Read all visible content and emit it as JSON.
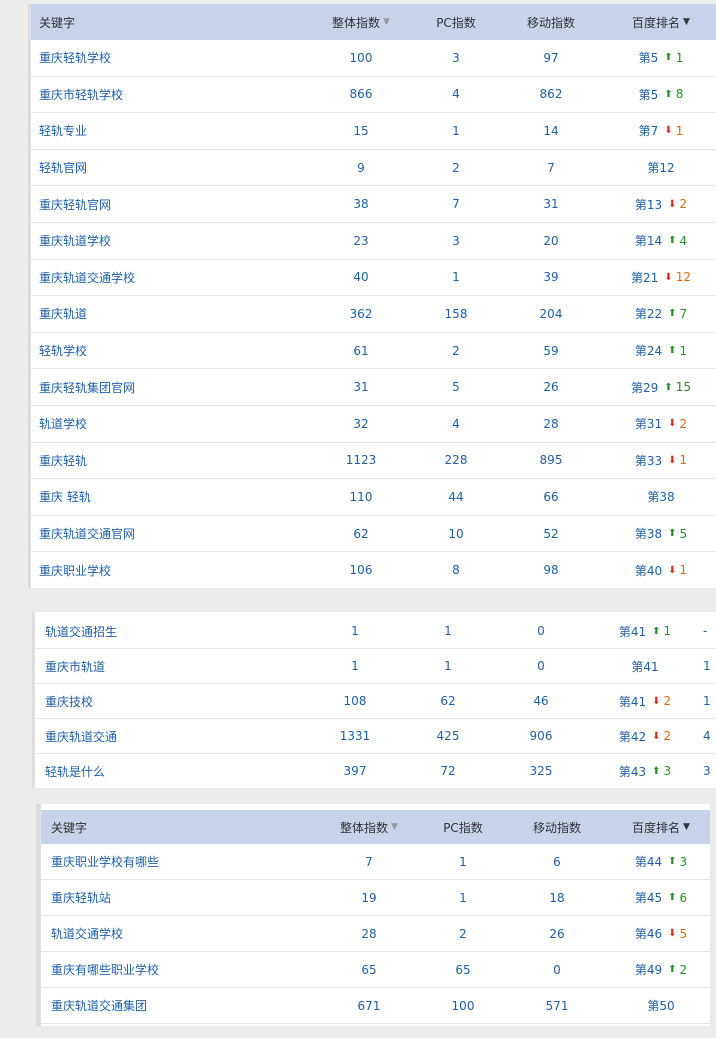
{
  "headers": {
    "keyword": "关键字",
    "overall": "整体指数",
    "pc": "PC指数",
    "mobile": "移动指数",
    "rank": "百度排名"
  },
  "table1": [
    {
      "kw": "重庆轻轨学校",
      "all": "100",
      "pc": "3",
      "mob": "97",
      "rank": "第5",
      "dir": "up",
      "chg": "1"
    },
    {
      "kw": "重庆市轻轨学校",
      "all": "866",
      "pc": "4",
      "mob": "862",
      "rank": "第5",
      "dir": "up",
      "chg": "8"
    },
    {
      "kw": "轻轨专业",
      "all": "15",
      "pc": "1",
      "mob": "14",
      "rank": "第7",
      "dir": "down",
      "chg": "1"
    },
    {
      "kw": "轻轨官网",
      "all": "9",
      "pc": "2",
      "mob": "7",
      "rank": "第12",
      "dir": "",
      "chg": ""
    },
    {
      "kw": "重庆轻轨官网",
      "all": "38",
      "pc": "7",
      "mob": "31",
      "rank": "第13",
      "dir": "down",
      "chg": "2"
    },
    {
      "kw": "重庆轨道学校",
      "all": "23",
      "pc": "3",
      "mob": "20",
      "rank": "第14",
      "dir": "up",
      "chg": "4"
    },
    {
      "kw": "重庆轨道交通学校",
      "all": "40",
      "pc": "1",
      "mob": "39",
      "rank": "第21",
      "dir": "down",
      "chg": "12"
    },
    {
      "kw": "重庆轨道",
      "all": "362",
      "pc": "158",
      "mob": "204",
      "rank": "第22",
      "dir": "up",
      "chg": "7"
    },
    {
      "kw": "轻轨学校",
      "all": "61",
      "pc": "2",
      "mob": "59",
      "rank": "第24",
      "dir": "up",
      "chg": "1"
    },
    {
      "kw": "重庆轻轨集团官网",
      "all": "31",
      "pc": "5",
      "mob": "26",
      "rank": "第29",
      "dir": "up",
      "chg": "15"
    },
    {
      "kw": "轨道学校",
      "all": "32",
      "pc": "4",
      "mob": "28",
      "rank": "第31",
      "dir": "down",
      "chg": "2"
    },
    {
      "kw": "重庆轻轨",
      "all": "1123",
      "pc": "228",
      "mob": "895",
      "rank": "第33",
      "dir": "down",
      "chg": "1"
    },
    {
      "kw": "重庆 轻轨",
      "all": "110",
      "pc": "44",
      "mob": "66",
      "rank": "第38",
      "dir": "",
      "chg": ""
    },
    {
      "kw": "重庆轨道交通官网",
      "all": "62",
      "pc": "10",
      "mob": "52",
      "rank": "第38",
      "dir": "up",
      "chg": "5"
    },
    {
      "kw": "重庆职业学校",
      "all": "106",
      "pc": "8",
      "mob": "98",
      "rank": "第40",
      "dir": "down",
      "chg": "1"
    }
  ],
  "table2": [
    {
      "kw": "轨道交通招生",
      "all": "1",
      "pc": "1",
      "mob": "0",
      "rank": "第41",
      "dir": "up",
      "chg": "1",
      "cut": "-"
    },
    {
      "kw": "重庆市轨道",
      "all": "1",
      "pc": "1",
      "mob": "0",
      "rank": "第41",
      "dir": "",
      "chg": "",
      "cut": "1"
    },
    {
      "kw": "重庆技校",
      "all": "108",
      "pc": "62",
      "mob": "46",
      "rank": "第41",
      "dir": "down",
      "chg": "2",
      "cut": "1"
    },
    {
      "kw": "重庆轨道交通",
      "all": "1331",
      "pc": "425",
      "mob": "906",
      "rank": "第42",
      "dir": "down",
      "chg": "2",
      "cut": "4"
    },
    {
      "kw": "轻轨是什么",
      "all": "397",
      "pc": "72",
      "mob": "325",
      "rank": "第43",
      "dir": "up",
      "chg": "3",
      "cut": "3"
    }
  ],
  "table3": [
    {
      "kw": "重庆职业学校有哪些",
      "all": "7",
      "pc": "1",
      "mob": "6",
      "rank": "第44",
      "dir": "up",
      "chg": "3"
    },
    {
      "kw": "重庆轻轨站",
      "all": "19",
      "pc": "1",
      "mob": "18",
      "rank": "第45",
      "dir": "up",
      "chg": "6"
    },
    {
      "kw": "轨道交通学校",
      "all": "28",
      "pc": "2",
      "mob": "26",
      "rank": "第46",
      "dir": "down",
      "chg": "5"
    },
    {
      "kw": "重庆有哪些职业学校",
      "all": "65",
      "pc": "65",
      "mob": "0",
      "rank": "第49",
      "dir": "up",
      "chg": "2"
    },
    {
      "kw": "重庆轨道交通集团",
      "all": "671",
      "pc": "100",
      "mob": "571",
      "rank": "第50",
      "dir": "",
      "chg": ""
    }
  ]
}
